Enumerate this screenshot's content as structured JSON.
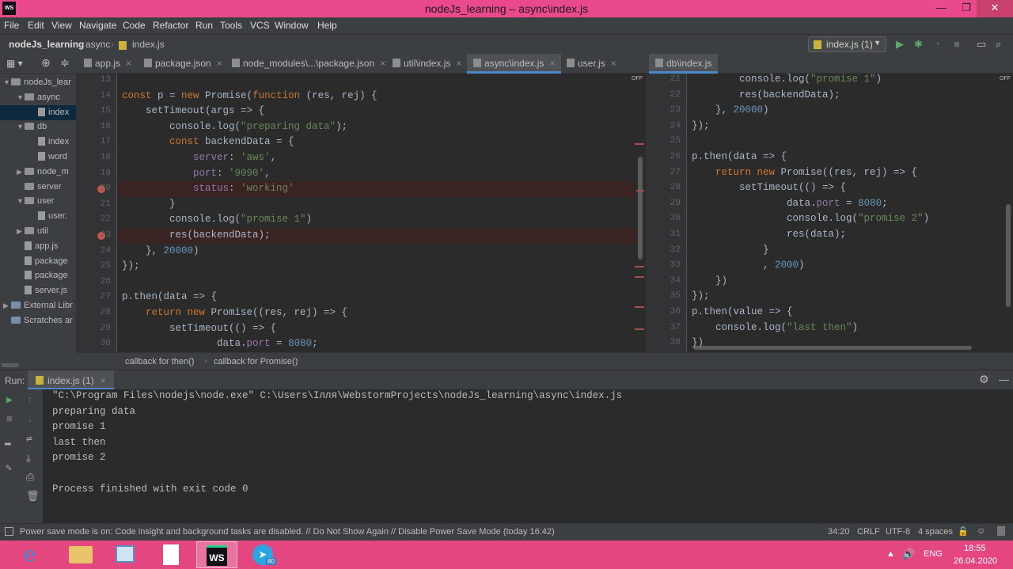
{
  "window": {
    "title": "nodeJs_learning – async\\index.js",
    "app_icon": "WS"
  },
  "menu": [
    "File",
    "Edit",
    "View",
    "Navigate",
    "Code",
    "Refactor",
    "Run",
    "Tools",
    "VCS",
    "Window",
    "Help"
  ],
  "breadcrumb": {
    "project": "nodeJs_learning",
    "folder": "async",
    "file": "index.js"
  },
  "run_config": {
    "label": "index.js (1)"
  },
  "left_tabs": [
    {
      "label": "app.js"
    },
    {
      "label": "package.json"
    },
    {
      "label": "node_modules\\...\\package.json"
    },
    {
      "label": "util\\index.js"
    },
    {
      "label": "async\\index.js"
    },
    {
      "label": "user.js"
    }
  ],
  "right_tabs": [
    {
      "label": "db\\index.js"
    }
  ],
  "project_tree": [
    {
      "label": "nodeJs_lear",
      "arrow": "▼",
      "type": "folder",
      "indent": 0
    },
    {
      "label": "async",
      "arrow": "▼",
      "type": "folder",
      "indent": 1
    },
    {
      "label": "index",
      "arrow": "",
      "type": "file",
      "indent": 2,
      "selected": true
    },
    {
      "label": "db",
      "arrow": "▼",
      "type": "folder",
      "indent": 1
    },
    {
      "label": "index",
      "arrow": "",
      "type": "file",
      "indent": 2
    },
    {
      "label": "word",
      "arrow": "",
      "type": "file",
      "indent": 2
    },
    {
      "label": "node_m",
      "arrow": "▶",
      "type": "folder",
      "indent": 1
    },
    {
      "label": "server",
      "arrow": "",
      "type": "folder",
      "indent": 1
    },
    {
      "label": "user",
      "arrow": "▼",
      "type": "folder",
      "indent": 1
    },
    {
      "label": "user.",
      "arrow": "",
      "type": "file",
      "indent": 2
    },
    {
      "label": "util",
      "arrow": "▶",
      "type": "folder",
      "indent": 1
    },
    {
      "label": "app.js",
      "arrow": "",
      "type": "file",
      "indent": 1
    },
    {
      "label": "package",
      "arrow": "",
      "type": "file",
      "indent": 1
    },
    {
      "label": "package",
      "arrow": "",
      "type": "file",
      "indent": 1
    },
    {
      "label": "server.js",
      "arrow": "",
      "type": "file",
      "indent": 1
    },
    {
      "label": "External Libr",
      "arrow": "▶",
      "type": "lib",
      "indent": 0
    },
    {
      "label": "Scratches ar",
      "arrow": "",
      "type": "lib",
      "indent": 0
    }
  ],
  "left_editor": {
    "off_label": "OFF",
    "lines": [
      {
        "n": "13",
        "html": ""
      },
      {
        "n": "14",
        "html": "<span class='kw'>const</span> p = <span class='kw'>new</span> Promise(<span class='kw'>function</span> (res, rej) {"
      },
      {
        "n": "15",
        "html": "    setTimeout(args => {"
      },
      {
        "n": "16",
        "html": "        console.log(<span class='str'>\"preparing data\"</span>);"
      },
      {
        "n": "17",
        "html": "        <span class='kw'>const</span> backendData = {"
      },
      {
        "n": "18",
        "html": "            <span class='prop'>server</span>: <span class='str'>'aws'</span>,"
      },
      {
        "n": "19",
        "html": "            <span class='prop'>port</span>: <span class='str'>'9090'</span>,"
      },
      {
        "n": "20",
        "html": "            <span class='prop'>status</span>: <span class='str'>'working'</span>",
        "bp": true
      },
      {
        "n": "21",
        "html": "        }"
      },
      {
        "n": "22",
        "html": "        console.log(<span class='str'>\"promise 1\"</span>)"
      },
      {
        "n": "23",
        "html": "        res(backendData);",
        "bp": true
      },
      {
        "n": "24",
        "html": "    }, <span class='num'>20000</span>)"
      },
      {
        "n": "25",
        "html": "});"
      },
      {
        "n": "26",
        "html": ""
      },
      {
        "n": "27",
        "html": "p.then(data => {"
      },
      {
        "n": "28",
        "html": "    <span class='kw'>return new</span> Promise((res, rej) => {"
      },
      {
        "n": "29",
        "html": "        setTimeout(() => {"
      },
      {
        "n": "30",
        "html": "                data.<span class='prop'>port</span> = <span class='num'>8080</span>;"
      }
    ]
  },
  "right_editor": {
    "off_label": "OFF",
    "lines": [
      {
        "n": "21",
        "html": "        console.log(<span class='str'>\"promise 1\"</span>)"
      },
      {
        "n": "22",
        "html": "        res(backendData);"
      },
      {
        "n": "23",
        "html": "    }, <span class='num'>20000</span>)"
      },
      {
        "n": "24",
        "html": "});"
      },
      {
        "n": "25",
        "html": ""
      },
      {
        "n": "26",
        "html": "p.then(data => {"
      },
      {
        "n": "27",
        "html": "    <span class='kw'>return new</span> Promise((res, rej) => {"
      },
      {
        "n": "28",
        "html": "        setTimeout(() => {"
      },
      {
        "n": "29",
        "html": "                data.<span class='prop'>port</span> = <span class='num'>8080</span>;"
      },
      {
        "n": "30",
        "html": "                console.log(<span class='str'>\"promise 2\"</span>)"
      },
      {
        "n": "31",
        "html": "                res(data);"
      },
      {
        "n": "32",
        "html": "            }"
      },
      {
        "n": "33",
        "html": "            , <span class='num'>2000</span>)"
      },
      {
        "n": "34",
        "html": "    })"
      },
      {
        "n": "35",
        "html": "});"
      },
      {
        "n": "36",
        "html": "p.then(value => {"
      },
      {
        "n": "37",
        "html": "    console.log(<span class='str'>\"last then\"</span>)"
      },
      {
        "n": "38",
        "html": "})"
      }
    ]
  },
  "code_breadcrumb": {
    "first": "callback for then()",
    "second": "callback for Promise()"
  },
  "run_panel": {
    "label": "Run:",
    "tab": "index.js (1)"
  },
  "console_lines": [
    "\"C:\\Program Files\\nodejs\\node.exe\" C:\\Users\\Ілля\\WebstormProjects\\nodeJs_learning\\async\\index.js",
    "preparing data",
    "promise 1",
    "last then",
    "promise 2",
    "",
    "Process finished with exit code 0"
  ],
  "status": {
    "message": "Power save mode is on: Code insight and background tasks are disabled. // Do Not Show Again // Disable Power Save Mode (today 16:42)",
    "position": "34:20",
    "line_sep": "CRLF",
    "encoding": "UTF-8",
    "indent": "4 spaces"
  },
  "taskbar": {
    "language": "ENG",
    "time": "18:55",
    "date": "26.04.2020",
    "telegram_badge": "80"
  }
}
